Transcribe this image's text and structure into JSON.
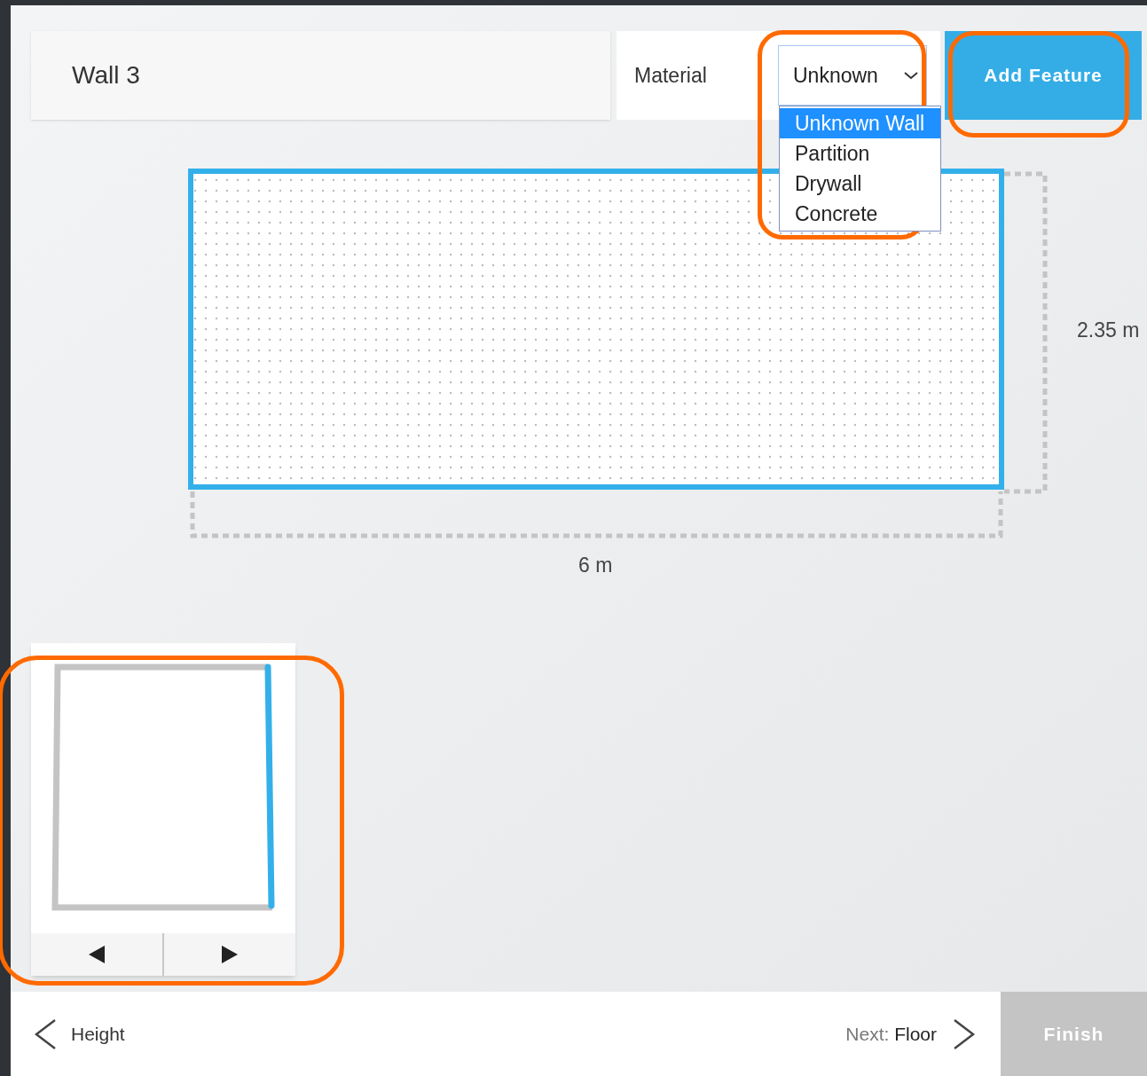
{
  "wall": {
    "title": "Wall 3"
  },
  "material": {
    "label": "Material",
    "value": "Unknown",
    "expanded": true,
    "options": [
      {
        "label": "Unknown Wall",
        "selected": true
      },
      {
        "label": "Partition",
        "selected": false
      },
      {
        "label": "Drywall",
        "selected": false
      },
      {
        "label": "Concrete",
        "selected": false
      }
    ]
  },
  "add_feature": {
    "label": "Add Feature"
  },
  "canvas": {
    "height_label": "2.35 m",
    "width_label": "6 m"
  },
  "footer": {
    "back": "Height",
    "next_prefix": "Next:",
    "next": "Floor",
    "finish": {
      "label": "Finish",
      "disabled": true
    }
  }
}
